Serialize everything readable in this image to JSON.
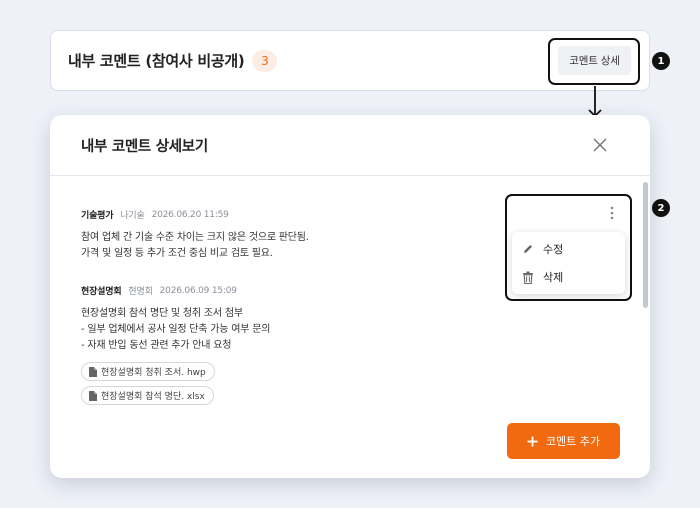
{
  "summary": {
    "title": "내부 코멘트 (참여사 비공개)",
    "count": "3",
    "detail_button_label": "코멘트 상세"
  },
  "markers": {
    "step1": "1",
    "step2": "2"
  },
  "modal": {
    "title": "내부 코멘트 상세보기",
    "comments": [
      {
        "category": "기술평가",
        "author": "나기술",
        "date": "2026.06.20 11:59",
        "lines": [
          "참여 업체 간 기술 수준 차이는 크지 않은 것으로 판단됨.",
          "가격 및 일정 등 추가 조건 중심 비교 검토 필요."
        ]
      },
      {
        "category": "현장설명회",
        "author": "현명회",
        "date": "2026.06.09 15:09",
        "lines": [
          "현장설명회 참석 명단 및 청취 조서 첨부",
          "- 일부 업체에서 공사 일정 단축 가능 여부 문의",
          "- 자재 반입 동선 관련 추가 안내 요청"
        ],
        "attachments": [
          "현장설명회 청취 조서. hwp",
          "현장설명회 참석 명단. xlsx"
        ]
      }
    ],
    "menu": {
      "edit_label": "수정",
      "delete_label": "삭제"
    },
    "add_button_label": "코멘트 추가"
  },
  "colors": {
    "accent": "#f26a0f",
    "badge_bg": "#fdeee5",
    "background": "#eef1f8"
  },
  "icons": [
    "close-icon",
    "kebab-icon",
    "pencil-icon",
    "trash-icon",
    "file-icon",
    "plus-icon",
    "arrow-down-icon"
  ]
}
